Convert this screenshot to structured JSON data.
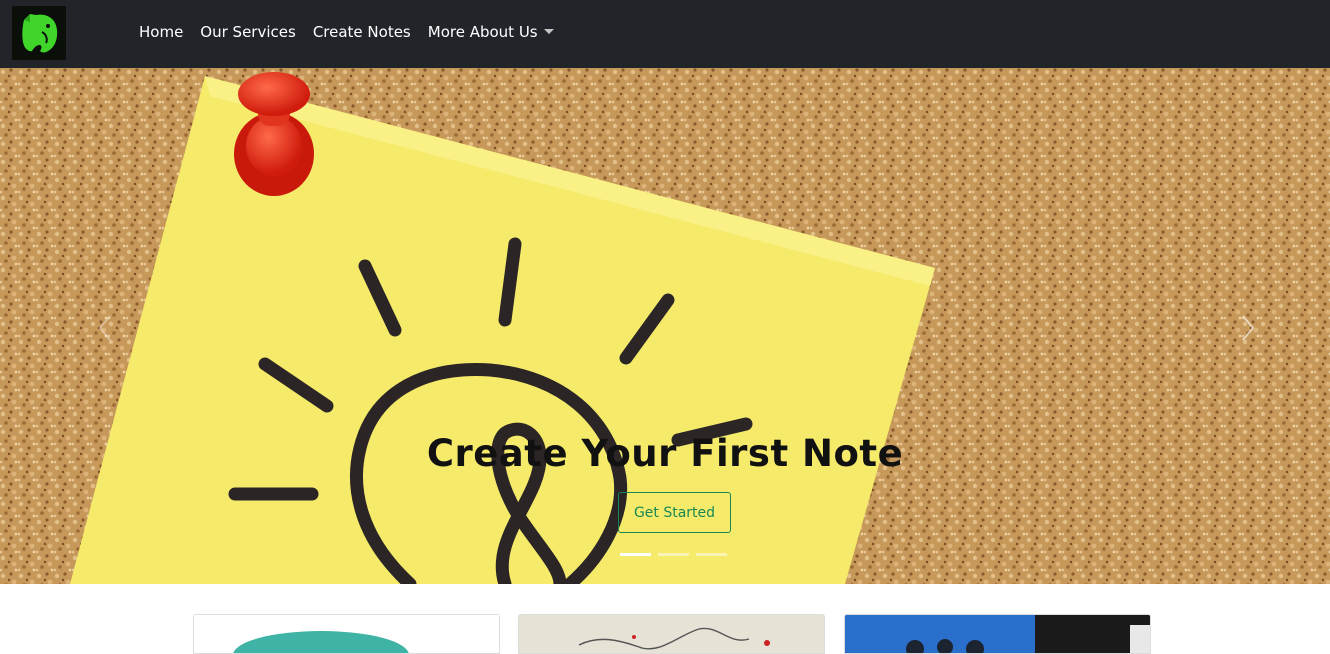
{
  "navbar": {
    "brand_icon": "elephant-logo-icon",
    "links": [
      {
        "label": "Home"
      },
      {
        "label": "Our Services"
      },
      {
        "label": "Create Notes"
      },
      {
        "label": "More About Us"
      }
    ]
  },
  "hero": {
    "title": "Create Your First Note",
    "button_label": "Get Started",
    "slide_count": 3,
    "active_slide": 1,
    "prev_icon": "chevron-left-icon",
    "next_icon": "chevron-right-icon"
  },
  "colors": {
    "navbar": "#212529",
    "logo_green": "#3fd52a",
    "button_outline": "#198754",
    "note_yellow": "#f5ea6a",
    "cork": "#c89a5c"
  }
}
